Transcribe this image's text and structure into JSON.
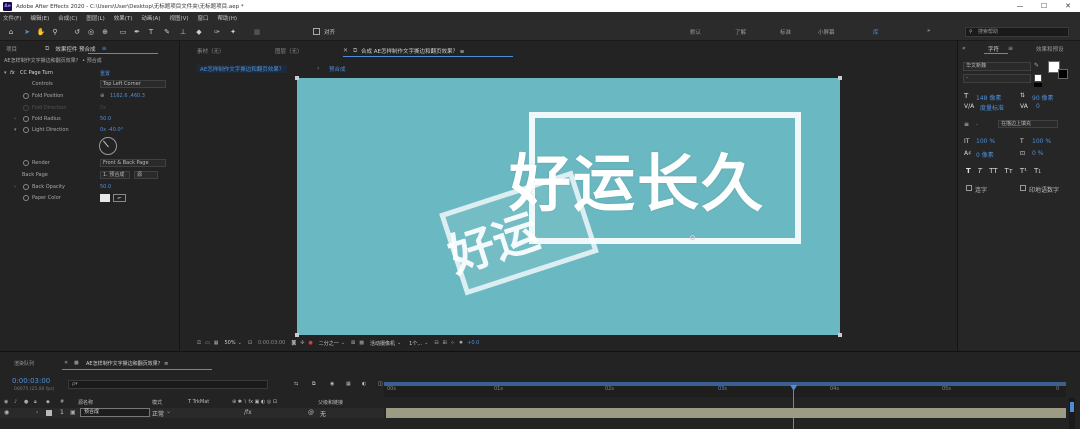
{
  "app": {
    "title": "Adobe After Effects 2020 - C:\\Users\\User\\Desktop\\无标题项目文件夹\\无标题项目.aep *",
    "logo": "Ae"
  },
  "menu": [
    "文件(F)",
    "编辑(E)",
    "合成(C)",
    "图层(L)",
    "效果(T)",
    "动画(A)",
    "视图(V)",
    "窗口",
    "帮助(H)"
  ],
  "toolbar": {
    "align_label": "对齐",
    "workspaces": [
      "默认",
      "了解",
      "标准",
      "小屏幕",
      "库"
    ],
    "search_placeholder": "搜索帮助",
    "more": "»"
  },
  "left_panel": {
    "tabs": {
      "project": "项目",
      "effects": "效果控件 预合成",
      "menu": "≡"
    },
    "breadcrumb": "AE怎样制作文字撕边和翻页效果？ • 预合成",
    "effect_name": "CC Page Turn",
    "reset_label": "重置",
    "fx": "fx",
    "props": [
      {
        "name": "Controls",
        "value": "Top Left Corner",
        "type": "dropdown"
      },
      {
        "name": "Fold Position",
        "value": "1162.6 ,460.3",
        "type": "value"
      },
      {
        "name": "Fold Direction",
        "value": "0x",
        "type": "disabled"
      },
      {
        "name": "Fold Radius",
        "value": "50.0",
        "type": "value"
      },
      {
        "name": "Light Direction",
        "value": "0x -40.0°",
        "type": "value"
      },
      {
        "name": "Render",
        "value": "Front & Back Page",
        "type": "dropdown"
      },
      {
        "name": "Back Page",
        "value": "1. 预合成",
        "type": "layer"
      },
      {
        "name": "Back Opacity",
        "value": "50.0",
        "type": "value"
      },
      {
        "name": "Paper Color",
        "value": "",
        "type": "color"
      }
    ],
    "back_page_source": "源"
  },
  "comp_panel": {
    "tabs": {
      "footage": "素材（无）",
      "layer": "图层（无）",
      "comp": "合成 AE怎样制作文字撕边和翻页效果？ ≡"
    },
    "nav": {
      "main": "AE怎样制作文字撕边和翻页效果？",
      "child": "预合成"
    },
    "canvas_text": {
      "main": "好运长久",
      "corner": "好运长久"
    },
    "footer": {
      "zoom": "50%",
      "timecode": "0:00:03:00",
      "resolution": "二分之一",
      "camera": "活动摄像机",
      "views": "1个...",
      "exposure": "+0.0"
    }
  },
  "right_panel": {
    "tabs": {
      "character": "字符",
      "effects_presets": "效果和预设"
    },
    "font_family": "华文新魏",
    "font_style": "-",
    "font_size": "148 像素",
    "leading": "90 像素",
    "kerning": "度量标准",
    "tracking": "0",
    "stroke_width": "-",
    "stroke_mode": "在描边上填充",
    "vscale": "100 %",
    "hscale": "100 %",
    "baseline": "0 像素",
    "tsume": "0 %",
    "styles": [
      "T",
      "T",
      "TT",
      "Tт",
      "T¹",
      "T₁"
    ],
    "ligatures": "连字",
    "hindi_digits": "印地语数字"
  },
  "timeline": {
    "tab_render": "渲染队列",
    "tab_comp": "AE怎样制作文字撕边和翻页效果？ ≡",
    "timecode": "0:00:03:00",
    "fps_info": "00075 (25.00 fps)",
    "search_placeholder": "ρ▾",
    "columns": {
      "source": "源名称",
      "mode": "模式",
      "trkmat": "T TrkMat",
      "parent": "父级和链接"
    },
    "layer": {
      "index": "1",
      "name": "预合成",
      "mode": "正常",
      "parent": "无"
    },
    "ruler": [
      "00s",
      "01s",
      "02s",
      "03s",
      "04s",
      "05s"
    ],
    "playhead_fraction": 0.6
  }
}
